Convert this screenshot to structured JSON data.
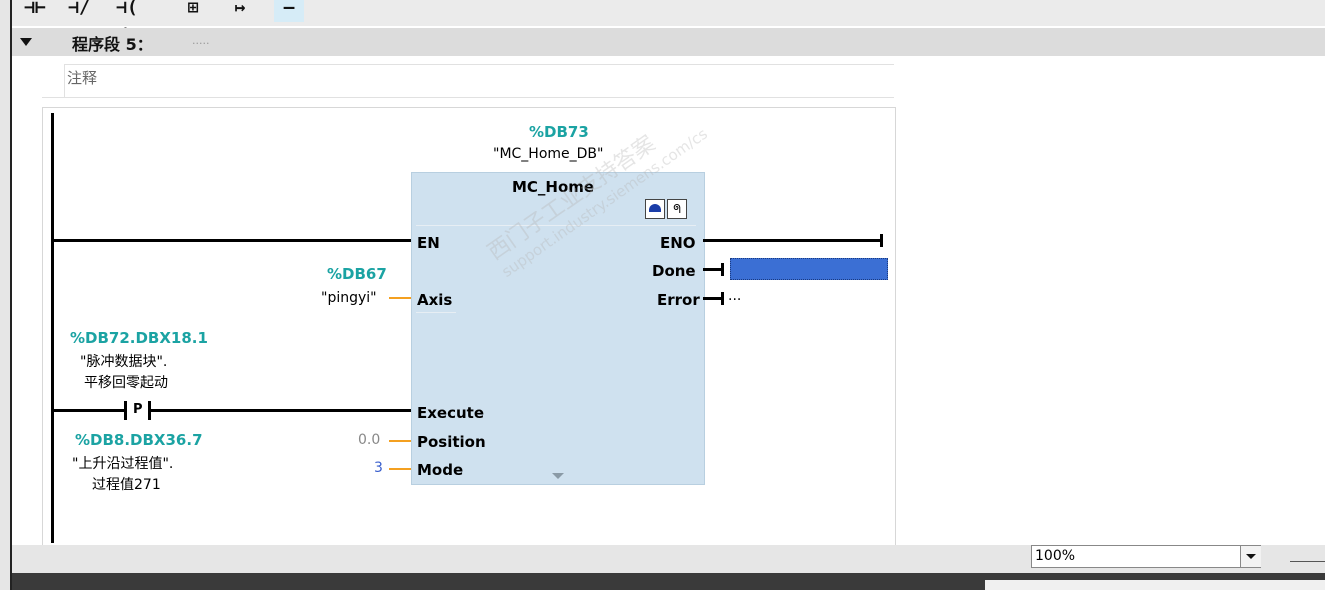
{
  "toolbar": {
    "buttons": [
      "⊣⊢",
      "⊣/⊢",
      "⊣( )",
      "⊞",
      "↦",
      "—"
    ]
  },
  "segment": {
    "title": "程序段 5：",
    "placeholder_dots": "....."
  },
  "comment": {
    "text": "注释"
  },
  "fb": {
    "db_addr": "%DB73",
    "db_name": "\"MC_Home_DB\"",
    "name": "MC_Home",
    "pin_en": "EN",
    "pin_eno": "ENO",
    "pin_done": "Done",
    "pin_error": "Error",
    "pin_axis": "Axis",
    "pin_execute": "Execute",
    "pin_position": "Position",
    "pin_mode": "Mode"
  },
  "axis_param": {
    "addr": "%DB67",
    "name": "\"pingyi\""
  },
  "contact": {
    "addr": "%DB72.DBX18.1",
    "name_line1": "\"脉冲数据块\".",
    "name_line2": "平移回零起动",
    "type": "P",
    "edge_addr": "%DB8.DBX36.7",
    "edge_line1": "\"上升沿过程值\".",
    "edge_line2": "过程值271"
  },
  "position_value": "0.0",
  "mode_value": "3",
  "error_out": "...",
  "watermark": {
    "line1": "西门子工业支持答案",
    "line2": "support.industry.siemens.com/cs"
  },
  "zoom": {
    "value": "100%"
  },
  "colors": {
    "accent_teal": "#1ba3a3",
    "fb_fill": "#cfe1ef",
    "param_wire": "#f4a020",
    "done_highlight": "#3b6fd4"
  }
}
